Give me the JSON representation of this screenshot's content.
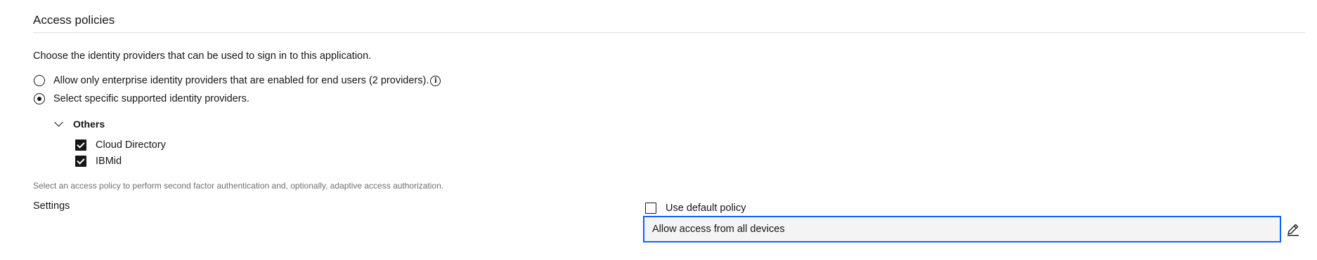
{
  "section": {
    "title": "Access policies",
    "description": "Choose the identity providers that can be used to sign in to this application."
  },
  "radios": [
    {
      "label": "Allow only enterprise identity providers that are enabled for end users (2 providers).",
      "checked": false
    },
    {
      "label": "Select specific supported identity providers.",
      "checked": true
    }
  ],
  "info_icon_glyph": "i",
  "group": {
    "label": "Others",
    "expanded": true,
    "providers": [
      {
        "label": "Cloud Directory",
        "checked": true
      },
      {
        "label": "IBMid",
        "checked": true
      }
    ]
  },
  "helper_text": "Select an access policy to perform second factor authentication and, optionally, adaptive access authorization.",
  "settings": {
    "label": "Settings",
    "default_policy": {
      "label": "Use default policy",
      "checked": false
    },
    "policy_value": "Allow access from all devices"
  },
  "colors": {
    "focus_border": "#0f62fe",
    "field_background": "#f4f4f4",
    "helper_text": "#6f6f6f"
  },
  "icons": {
    "info": "info-icon",
    "chevron": "chevron-down-icon",
    "edit": "edit-pencil-icon"
  }
}
